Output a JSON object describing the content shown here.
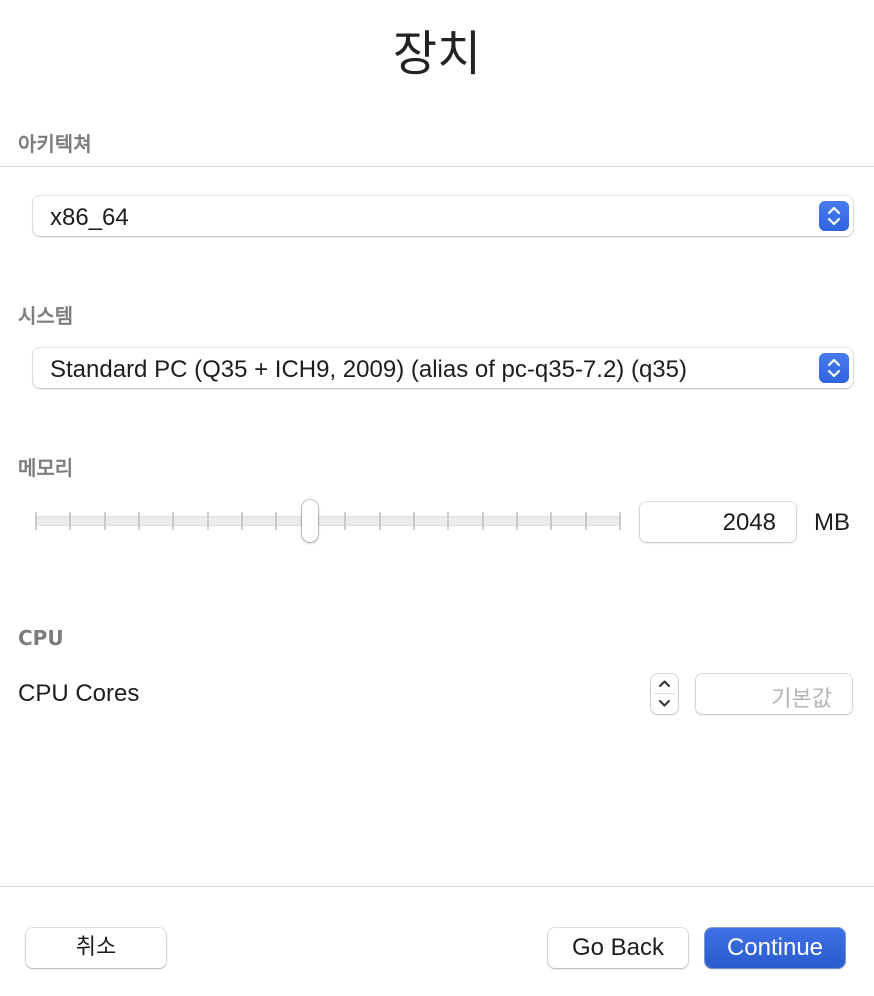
{
  "title": "장치",
  "architecture": {
    "label": "아키텍쳐",
    "selected": "x86_64"
  },
  "system": {
    "label": "시스템",
    "selected": "Standard PC (Q35 + ICH9, 2009) (alias of pc-q35-7.2) (q35)"
  },
  "memory": {
    "label": "메모리",
    "value": "2048",
    "unit": "MB",
    "slider_fraction": 0.47
  },
  "cpu": {
    "label": "CPU",
    "cores_label": "CPU Cores",
    "cores_placeholder": "기본값"
  },
  "footer": {
    "cancel_label": "취소",
    "back_label": "Go Back",
    "continue_label": "Continue"
  },
  "colors": {
    "accent": "#3366dd",
    "section_label": "#7d7d7d"
  }
}
